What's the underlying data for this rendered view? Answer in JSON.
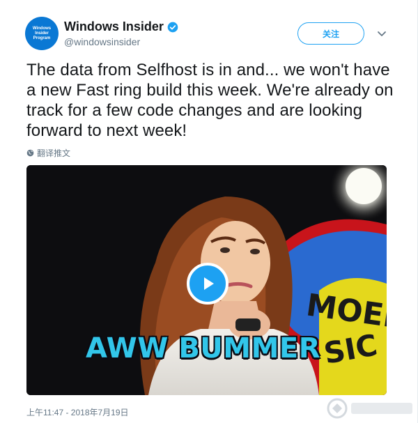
{
  "author": {
    "display_name": "Windows Insider",
    "handle": "@windowsinsider",
    "avatar_lines": [
      "Windows",
      "Insider",
      "Program"
    ],
    "verified": true
  },
  "follow_button": {
    "label": "关注"
  },
  "tweet": {
    "text": "The data from Selfhost is in and... we won't have a new Fast ring build this week.  We're already on track for a few code changes and are looking forward to next week!",
    "translate_label": "翻译推文"
  },
  "media": {
    "type": "gif-video",
    "caption": "AWW BUMMER",
    "background_sign": "MOEBA SIC"
  },
  "timestamp": "上午11:47 - 2018年7月19日",
  "colors": {
    "accent": "#1da1f2",
    "text_primary": "#14171a",
    "text_secondary": "#657786",
    "caption": "#32c6ea",
    "avatar_bg": "#0a78d4"
  }
}
